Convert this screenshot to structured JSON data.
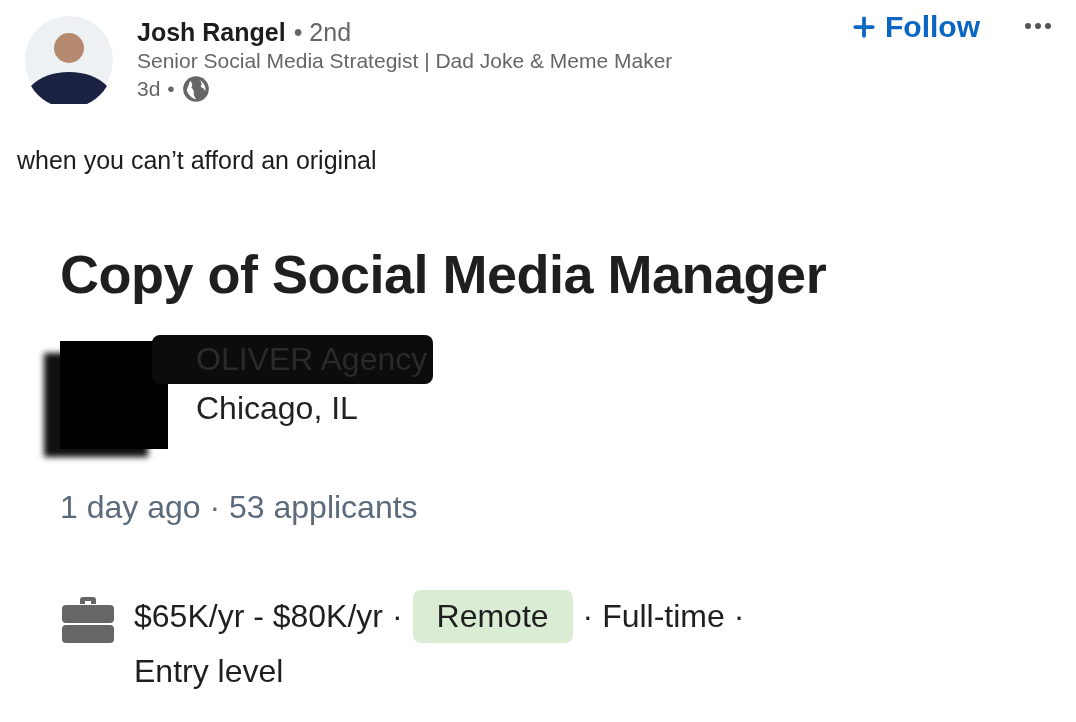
{
  "post": {
    "author": {
      "name": "Josh Rangel",
      "degree": "• 2nd",
      "headline": "Senior Social Media Strategist | Dad Joke & Meme Maker",
      "age": "3d",
      "separator": "•"
    },
    "follow_button": {
      "label": "Follow"
    },
    "text": "when you can’t afford an original"
  },
  "job": {
    "title": "Copy of Social Media Manager",
    "company": "OLIVER Agency",
    "location": "Chicago, IL",
    "meta": "1 day ago · 53 applicants",
    "insights": [
      {
        "kind": "text",
        "text": "$65K/yr - $80K/yr ·"
      },
      {
        "kind": "badge",
        "text": "Remote"
      },
      {
        "kind": "text",
        "text": "· Full-time ·"
      },
      {
        "kind": "text",
        "text": "Entry level"
      }
    ]
  }
}
